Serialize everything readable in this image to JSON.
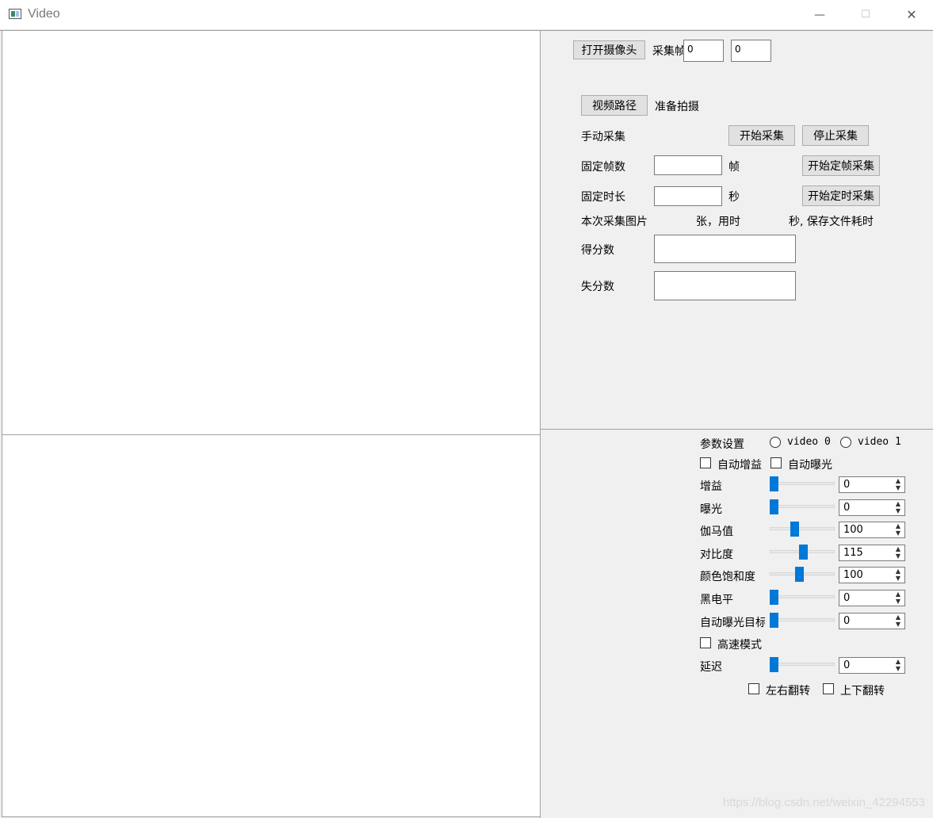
{
  "window": {
    "title": "Video",
    "minimize_glyph": "—",
    "maximize_glyph": "☐",
    "close_glyph": "✕"
  },
  "top_panel": {
    "open_camera": "打开摄像头",
    "capture_frame_label": "采集帧",
    "frame_value_1": "0",
    "frame_value_2": "0",
    "video_path": "视频路径",
    "status": "准备拍摄",
    "manual_capture": "手动采集",
    "start_capture": "开始采集",
    "stop_capture": "停止采集",
    "fixed_frames": "固定帧数",
    "frames_unit": "帧",
    "start_fixed_frame": "开始定帧采集",
    "fixed_duration": "固定时长",
    "seconds_unit": "秒",
    "start_timed": "开始定时采集",
    "summary_prefix": "本次采集图片",
    "summary_mid": "张，用时",
    "summary_suffix": "秒, 保存文件耗时",
    "score": "得分数",
    "lost_score": "失分数"
  },
  "params": {
    "title": "参数设置",
    "video0": "video 0",
    "video1": "video 1",
    "auto_gain": "自动增益",
    "auto_exposure": "自动曝光",
    "rows": [
      {
        "label": "增益",
        "value": "0",
        "level": 0.0
      },
      {
        "label": "曝光",
        "value": "0",
        "level": 0.0
      },
      {
        "label": "伽马值",
        "value": "100",
        "level": 0.37
      },
      {
        "label": "对比度",
        "value": "115",
        "level": 0.52
      },
      {
        "label": "颜色饱和度",
        "value": "100",
        "level": 0.45
      },
      {
        "label": "黑电平",
        "value": "0",
        "level": 0.0
      },
      {
        "label": "自动曝光目标",
        "value": "0",
        "level": 0.0
      }
    ],
    "high_speed": "高速模式",
    "delay_label": "延迟",
    "delay_value": "0",
    "flip_lr": "左右翻转",
    "flip_ud": "上下翻转"
  },
  "watermark": "https://blog.csdn.net/weixin_42294553"
}
